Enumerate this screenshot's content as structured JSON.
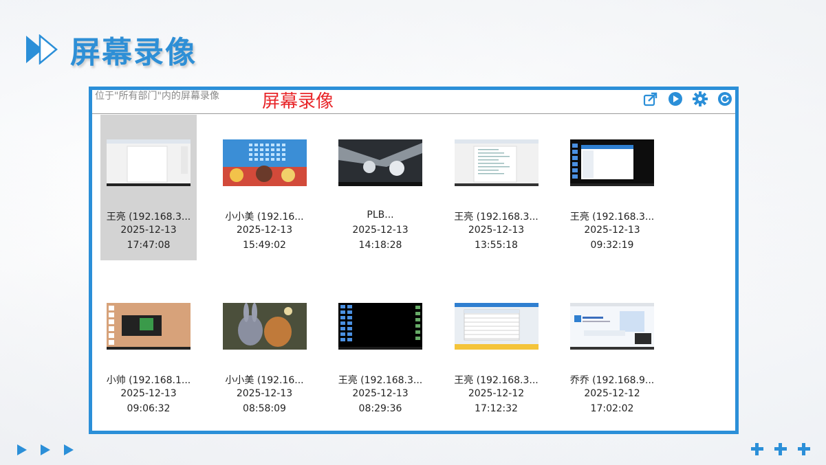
{
  "slide": {
    "title": "屏幕录像"
  },
  "panel": {
    "location": "位于\"所有部门\"内的屏幕录像",
    "overlay_label": "屏幕录像",
    "icons": [
      "share-icon",
      "play-icon",
      "settings-icon",
      "refresh-icon"
    ]
  },
  "recordings": [
    {
      "name": "王亮 (192.168.3...",
      "date": "2025-12-13",
      "time": "17:47:08",
      "selected": true,
      "thumb": "doc-light"
    },
    {
      "name": "小小美 (192.16...",
      "date": "2025-12-13",
      "time": "15:49:02",
      "selected": false,
      "thumb": "desktop-anime"
    },
    {
      "name": "PLB...",
      "date": "2025-12-13",
      "time": "14:18:28",
      "selected": false,
      "thumb": "ice-dark"
    },
    {
      "name": "王亮 (192.168.3...",
      "date": "2025-12-13",
      "time": "13:55:18",
      "selected": false,
      "thumb": "doc-text"
    },
    {
      "name": "王亮 (192.168.3...",
      "date": "2025-12-13",
      "time": "09:32:19",
      "selected": false,
      "thumb": "desktop-window"
    },
    {
      "name": "小帅 (192.168.1...",
      "date": "2025-12-13",
      "time": "09:06:32",
      "selected": false,
      "thumb": "desktop-tan"
    },
    {
      "name": "小小美 (192.16...",
      "date": "2025-12-13",
      "time": "08:58:09",
      "selected": false,
      "thumb": "anime-rabbit"
    },
    {
      "name": "王亮 (192.168.3...",
      "date": "2025-12-13",
      "time": "08:29:36",
      "selected": false,
      "thumb": "desktop-dark"
    },
    {
      "name": "王亮 (192.168.3...",
      "date": "2025-12-12",
      "time": "17:12:32",
      "selected": false,
      "thumb": "spreadsheet"
    },
    {
      "name": "乔乔 (192.168.9...",
      "date": "2025-12-12",
      "time": "17:02:02",
      "selected": false,
      "thumb": "web-page"
    }
  ],
  "colors": {
    "accent": "#2b8fd8",
    "overlay_label": "#e8262a",
    "selected_tile": "#d3d3d3"
  }
}
